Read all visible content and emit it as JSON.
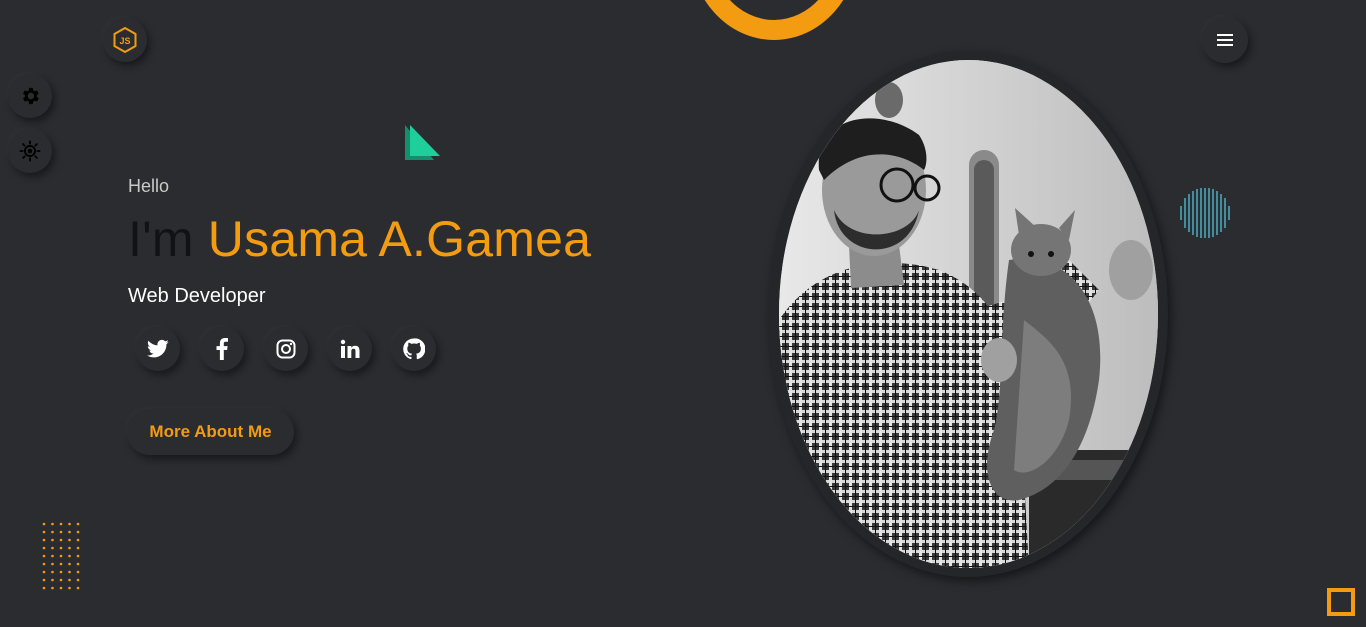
{
  "header": {
    "logo_icon": "nodejs-hexagon-icon",
    "menu_icon": "hamburger-menu-icon"
  },
  "sidebar": {
    "items": [
      {
        "icon": "gear-icon"
      },
      {
        "icon": "sun-icon"
      }
    ]
  },
  "hero": {
    "greeting": "Hello",
    "intro": "I'm",
    "name": "Usama A.Gamea",
    "role": "Web Developer",
    "cta_label": "More About Me",
    "socials": [
      {
        "icon": "twitter-icon"
      },
      {
        "icon": "facebook-icon"
      },
      {
        "icon": "instagram-icon"
      },
      {
        "icon": "linkedin-icon"
      },
      {
        "icon": "github-icon"
      }
    ]
  },
  "portrait": {
    "icon": "portrait-photo"
  },
  "colors": {
    "background": "#2b2c30",
    "accent": "#f39c12",
    "teal": "#1abc9c",
    "cyan": "#4fc3d9",
    "heading_dark": "#111214"
  }
}
